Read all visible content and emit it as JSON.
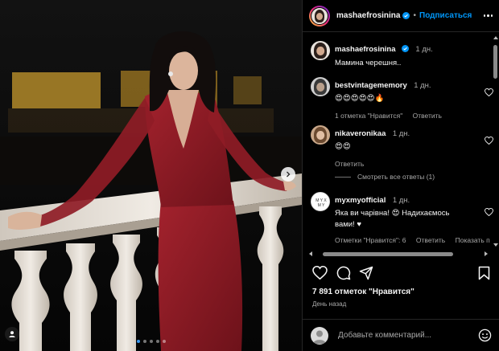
{
  "post": {
    "author": "mashaefrosinina",
    "follow_label": "Подписаться",
    "likes_text": "7 891 отметок \"Нравится\"",
    "posted_ago": "День назад",
    "add_comment_placeholder": "Добавьте комментарий...",
    "carousel": {
      "total": 5,
      "active": 1
    }
  },
  "caption": {
    "user": "mashaefrosinina",
    "time": "1 дн.",
    "text": "Мамина черешня.."
  },
  "comments": [
    {
      "user": "bestvintagememory",
      "time": "1 дн.",
      "text": "😍😍😍😍😍🔥",
      "likes": "1 отметка \"Нравится\"",
      "reply": "Ответить"
    },
    {
      "user": "nikaveronikaa",
      "time": "1 дн.",
      "text": "😍😍",
      "reply": "Ответить",
      "view_replies": "Смотреть все ответы (1)"
    },
    {
      "user": "myxmyofficial",
      "time": "1 дн.",
      "text_line1": "Яка ви чарівна! 😍 Надихаємось",
      "text_line2": "вами! ♥",
      "likes": "Отметки \"Нравится\": 6",
      "reply": "Ответить",
      "translate": "Показать п"
    }
  ],
  "colors": {
    "accent": "#0095f6",
    "dress": "#8e1b25",
    "background": "#000000"
  }
}
